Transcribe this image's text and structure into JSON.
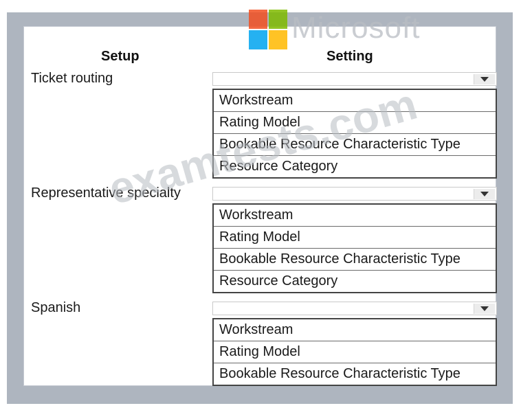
{
  "headers": {
    "setup": "Setup",
    "setting": "Setting"
  },
  "watermarks": {
    "brand": "Microsoft",
    "site": "examtests.com"
  },
  "logo_colors": [
    "#f25022",
    "#7fba00",
    "#00a4ef",
    "#ffb900"
  ],
  "rows": [
    {
      "label": "Ticket routing",
      "selected": "",
      "options": [
        "Workstream",
        "Rating Model",
        "Bookable Resource Characteristic Type",
        "Resource Category"
      ]
    },
    {
      "label": "Representative specialty",
      "selected": "",
      "options": [
        "Workstream",
        "Rating Model",
        "Bookable Resource Characteristic Type",
        "Resource Category"
      ]
    },
    {
      "label": "Spanish",
      "selected": "",
      "options": [
        "Workstream",
        "Rating Model",
        "Bookable Resource Characteristic Type"
      ]
    }
  ]
}
